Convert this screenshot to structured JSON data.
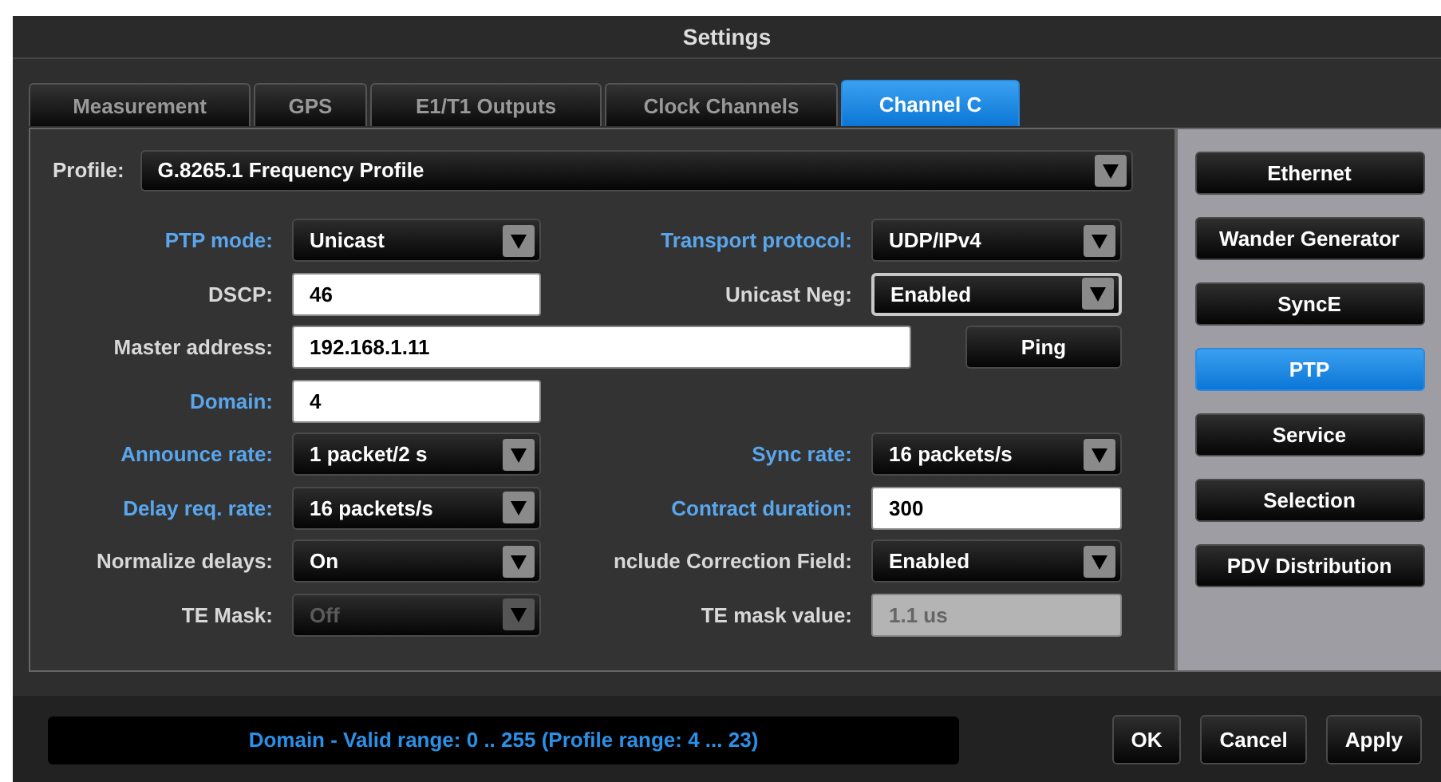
{
  "window": {
    "title": "Settings"
  },
  "tabs": [
    {
      "label": "Measurement",
      "selected": false
    },
    {
      "label": "GPS",
      "selected": false
    },
    {
      "label": "E1/T1 Outputs",
      "selected": false
    },
    {
      "label": "Clock Channels",
      "selected": false
    },
    {
      "label": "Channel C",
      "selected": true
    }
  ],
  "profile": {
    "label": "Profile:",
    "value": "G.8265.1 Frequency Profile"
  },
  "rows": [
    {
      "fields": [
        {
          "label": "PTP mode:",
          "highlighted": true,
          "kind": "select",
          "value": "Unicast",
          "disabled": false,
          "focused": false
        },
        {
          "label": "Transport protocol:",
          "highlighted": true,
          "kind": "select",
          "value": "UDP/IPv4",
          "disabled": false,
          "focused": false
        }
      ]
    },
    {
      "fields": [
        {
          "label": "DSCP:",
          "highlighted": false,
          "kind": "input",
          "value": "46",
          "disabled": false,
          "focused": false
        },
        {
          "label": "Unicast Neg:",
          "highlighted": false,
          "kind": "select",
          "value": "Enabled",
          "disabled": false,
          "focused": true
        }
      ]
    },
    {
      "fields": [
        {
          "label": "Master address:",
          "highlighted": false,
          "kind": "wide_input",
          "value": "192.168.1.11",
          "disabled": false,
          "focused": false
        }
      ],
      "button": "Ping"
    },
    {
      "fields": [
        {
          "label": "Domain:",
          "highlighted": true,
          "kind": "input",
          "value": "4",
          "disabled": false,
          "focused": false
        }
      ]
    },
    {
      "fields": [
        {
          "label": "Announce rate:",
          "highlighted": true,
          "kind": "select",
          "value": "1 packet/2 s",
          "disabled": false,
          "focused": false
        },
        {
          "label": "Sync rate:",
          "highlighted": true,
          "kind": "select",
          "value": "16 packets/s",
          "disabled": false,
          "focused": false
        }
      ]
    },
    {
      "fields": [
        {
          "label": "Delay req. rate:",
          "highlighted": true,
          "kind": "select",
          "value": "16 packets/s",
          "disabled": false,
          "focused": false
        },
        {
          "label": "Contract duration:",
          "highlighted": true,
          "kind": "input",
          "value": "300",
          "disabled": false,
          "focused": false
        }
      ]
    },
    {
      "fields": [
        {
          "label": "Normalize delays:",
          "highlighted": false,
          "kind": "select",
          "value": "On",
          "disabled": false,
          "focused": false
        },
        {
          "label": "nclude Correction Field:",
          "highlighted": false,
          "kind": "select",
          "value": "Enabled",
          "disabled": false,
          "focused": false
        }
      ]
    },
    {
      "fields": [
        {
          "label": "TE Mask:",
          "highlighted": false,
          "kind": "select",
          "value": "Off",
          "disabled": true,
          "focused": false
        },
        {
          "label": "TE mask value:",
          "highlighted": false,
          "kind": "input",
          "value": "1.1 us",
          "disabled": true,
          "focused": false
        }
      ]
    }
  ],
  "side_menu": [
    {
      "label": "Ethernet",
      "selected": false
    },
    {
      "label": "Wander Generator",
      "selected": false
    },
    {
      "label": "SyncE",
      "selected": false
    },
    {
      "label": "PTP",
      "selected": true
    },
    {
      "label": "Service",
      "selected": false
    },
    {
      "label": "Selection",
      "selected": false
    },
    {
      "label": "PDV Distribution",
      "selected": false
    }
  ],
  "status_bar": {
    "message": "Domain - Valid range: 0 .. 255 (Profile range: 4 ... 23)"
  },
  "buttons": [
    "OK",
    "Cancel",
    "Apply"
  ]
}
